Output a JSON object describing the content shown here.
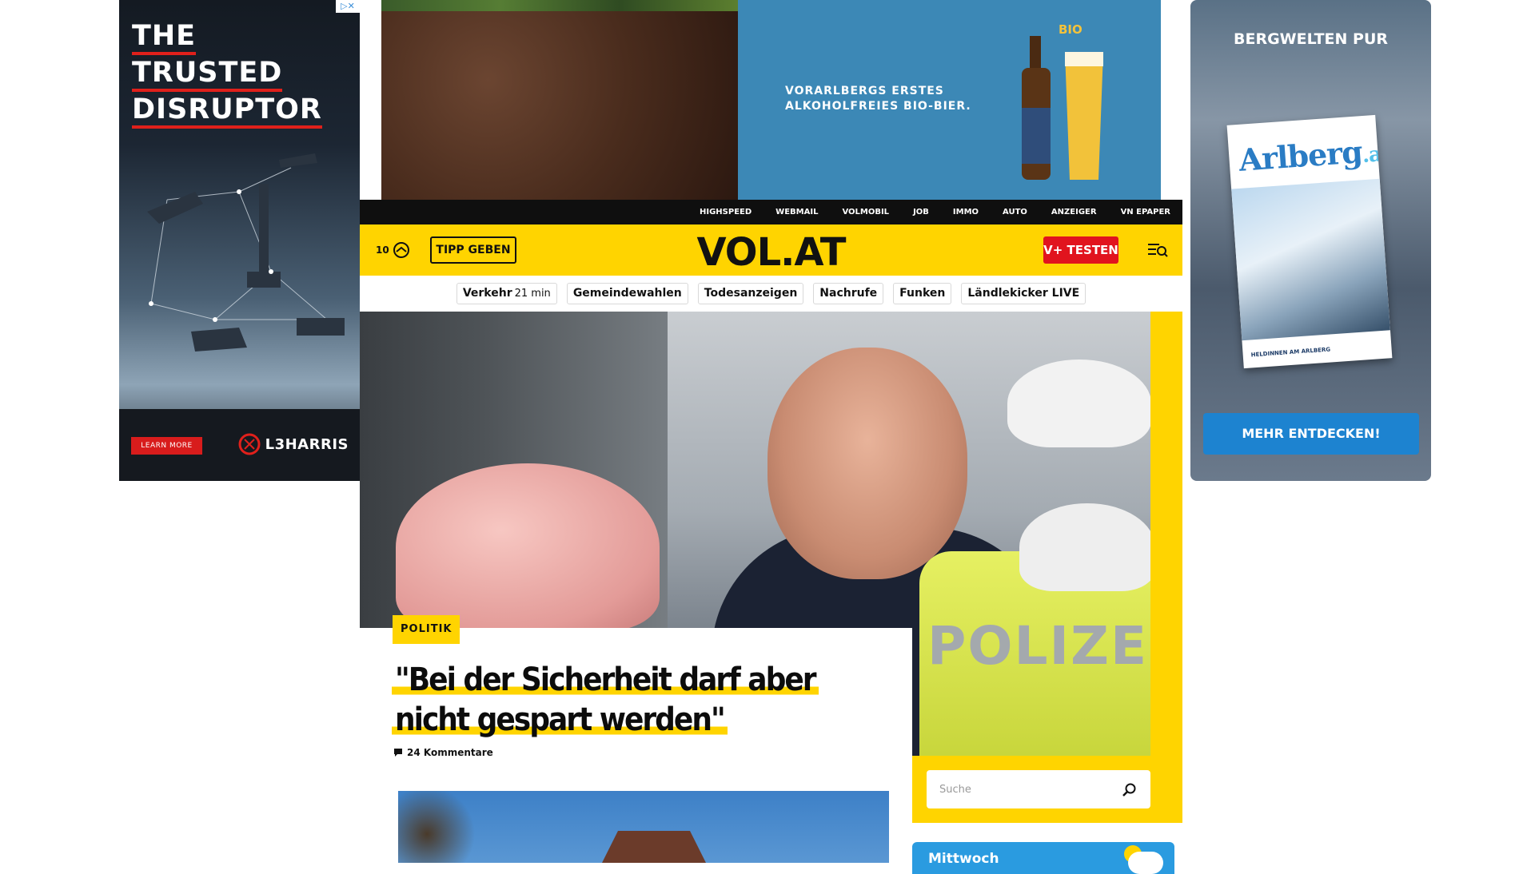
{
  "ads": {
    "left": {
      "adchoices": "▷✕",
      "headline": [
        "THE",
        "TRUSTED",
        "DISRUPTOR"
      ],
      "cta": "LEARN MORE",
      "brand": "L3HARRIS"
    },
    "top": {
      "copy_line1": "VORARLBERGS ERSTES",
      "copy_line2": "ALKOHOLFREIES BIO-BIER.",
      "bio": "BIO"
    },
    "right": {
      "title": "BERGWELTEN PUR",
      "magazine_title": "Arlberg",
      "magazine_suffix": ".at",
      "magazine_caption": "HELDINNEN AM ARLBERG",
      "cta": "MEHR ENTDECKEN!"
    }
  },
  "topnav": {
    "items": [
      "HIGHSPEED",
      "WEBMAIL",
      "VOLMOBIL",
      "JOB",
      "IMMO",
      "AUTO",
      "ANZEIGER",
      "VN EPAPER"
    ]
  },
  "header": {
    "counter": "10",
    "tipp_label": "TIPP GEBEN",
    "logo": "VOL.AT",
    "vplus_label": "V+ TESTEN"
  },
  "chips": [
    {
      "label": "Verkehr",
      "sub": "21 min"
    },
    {
      "label": "Gemeindewahlen"
    },
    {
      "label": "Todesanzeigen"
    },
    {
      "label": "Nachrufe"
    },
    {
      "label": "Funken"
    },
    {
      "label": "Ländlekicker LIVE"
    }
  ],
  "article": {
    "category": "POLITIK",
    "title": "\"Bei der Sicherheit darf aber nicht gespart werden\"",
    "comments": "24 Kommentare"
  },
  "hero": {
    "vest_text": "POLIZE"
  },
  "search": {
    "placeholder": "Suche"
  },
  "weather": {
    "day": "Mittwoch"
  },
  "colors": {
    "brand_yellow": "#ffd400",
    "vplus_red": "#e1141e",
    "nav_black": "#0f0f0f",
    "weather_blue": "#2a9be0"
  }
}
